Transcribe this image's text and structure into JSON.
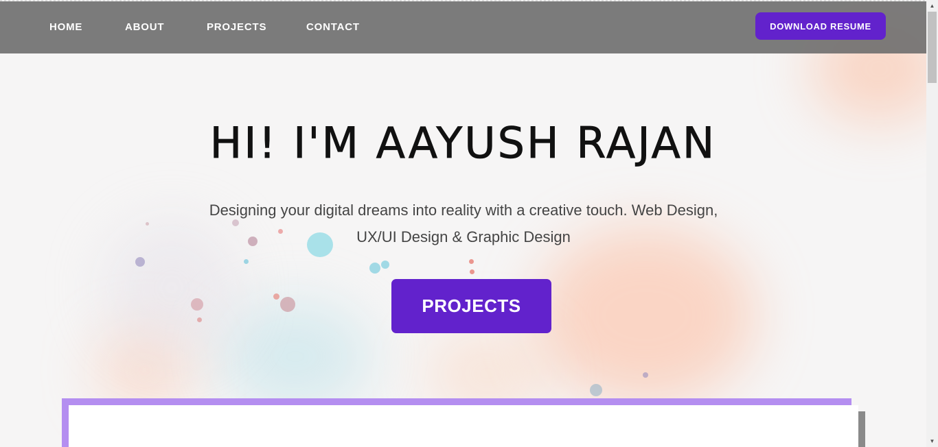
{
  "nav": {
    "links": [
      "HOME",
      "ABOUT",
      "PROJECTS",
      "CONTACT"
    ],
    "resume_button": "DOWNLOAD RESUME"
  },
  "hero": {
    "title": "HI! I'M AAYUSH RAJAN",
    "subtitle_line1": "Designing your digital dreams into reality with a creative touch. Web Design,",
    "subtitle_line2": "UX/UI Design & Graphic Design",
    "cta": "PROJECTS"
  },
  "icons": {
    "scroll_up": "triangle-up-icon",
    "scroll_down": "triangle-down-icon"
  },
  "colors": {
    "accent": "#6222cc",
    "navbar": "#6e6e6e",
    "card_border": "#b48ef0",
    "page_background": "#f6f5f5"
  }
}
